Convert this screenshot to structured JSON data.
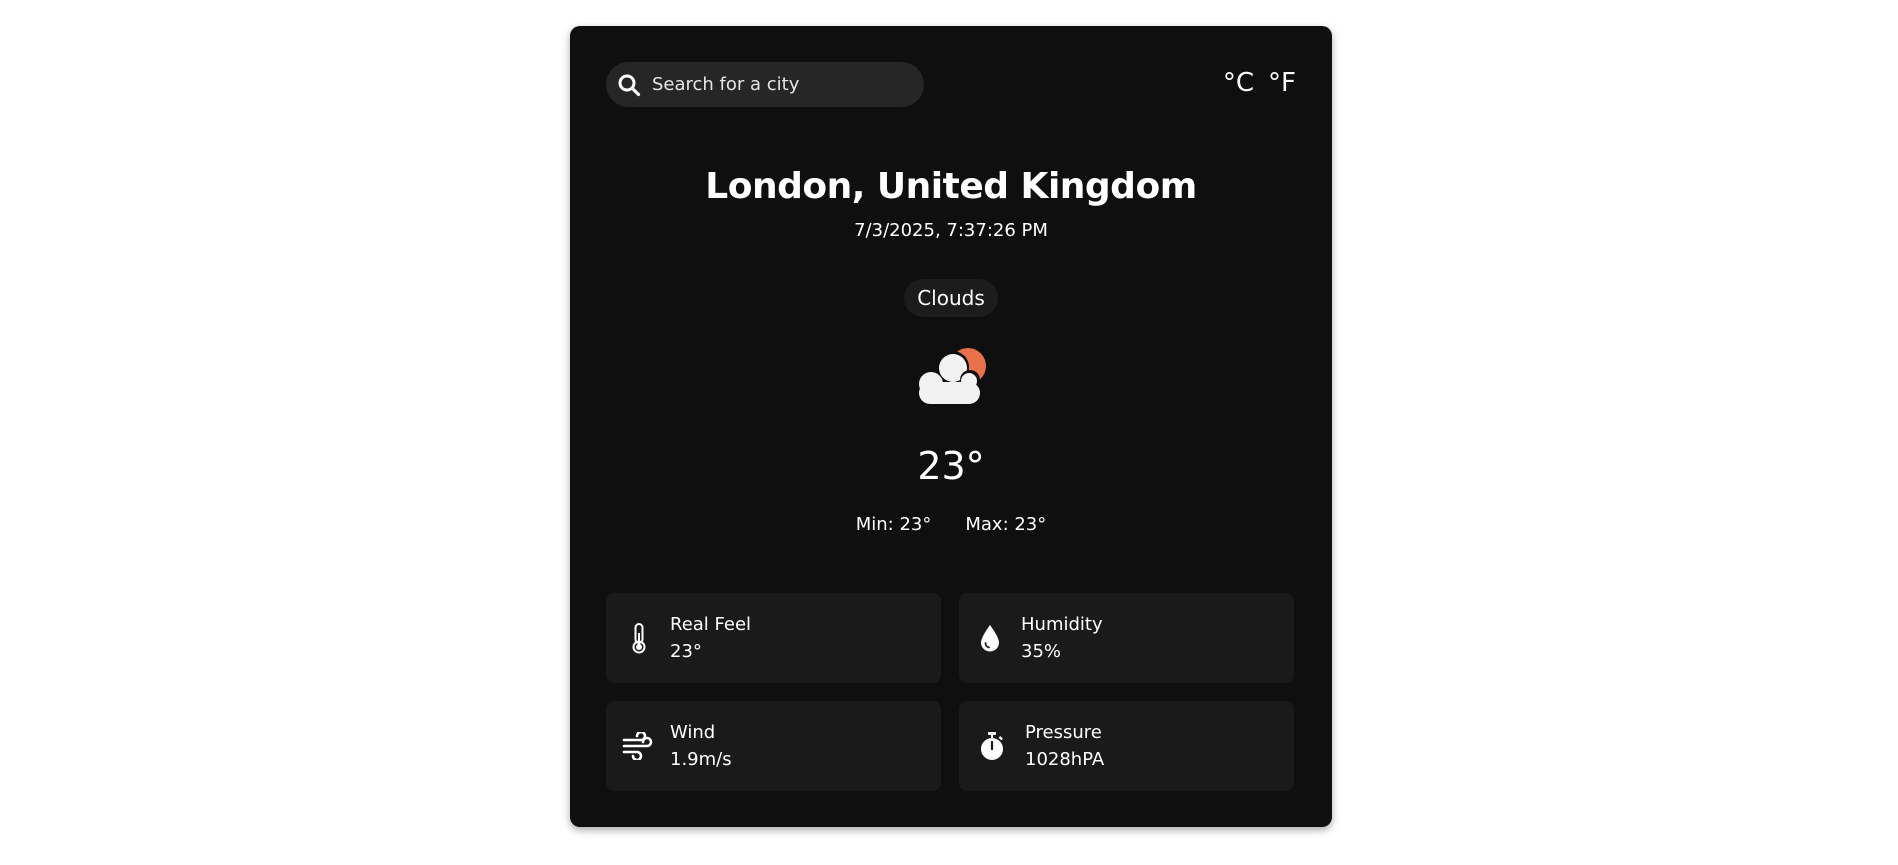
{
  "search": {
    "placeholder": "Search for a city",
    "value": ""
  },
  "units": {
    "celsius": "°C",
    "fahrenheit": "°F"
  },
  "location": {
    "city": "London, United Kingdom",
    "datetime": "7/3/2025, 7:37:26 PM"
  },
  "weather": {
    "condition": "Clouds",
    "icon": "cloud-sun-icon",
    "temperature": "23°",
    "min": "Min: 23°",
    "max": "Max: 23°"
  },
  "details": {
    "real_feel": {
      "label": "Real Feel",
      "value": "23°",
      "icon": "thermometer-icon"
    },
    "humidity": {
      "label": "Humidity",
      "value": "35%",
      "icon": "droplet-icon"
    },
    "wind": {
      "label": "Wind",
      "value": "1.9m/s",
      "icon": "wind-icon"
    },
    "pressure": {
      "label": "Pressure",
      "value": "1028hPA",
      "icon": "stopwatch-icon"
    }
  },
  "colors": {
    "card_background": "#0f0f0f",
    "search_background": "#262626",
    "tile_background": "#1a1a1a",
    "sun": "#e8704a",
    "cloud": "#f2f2f2",
    "text": "#ffffff"
  }
}
